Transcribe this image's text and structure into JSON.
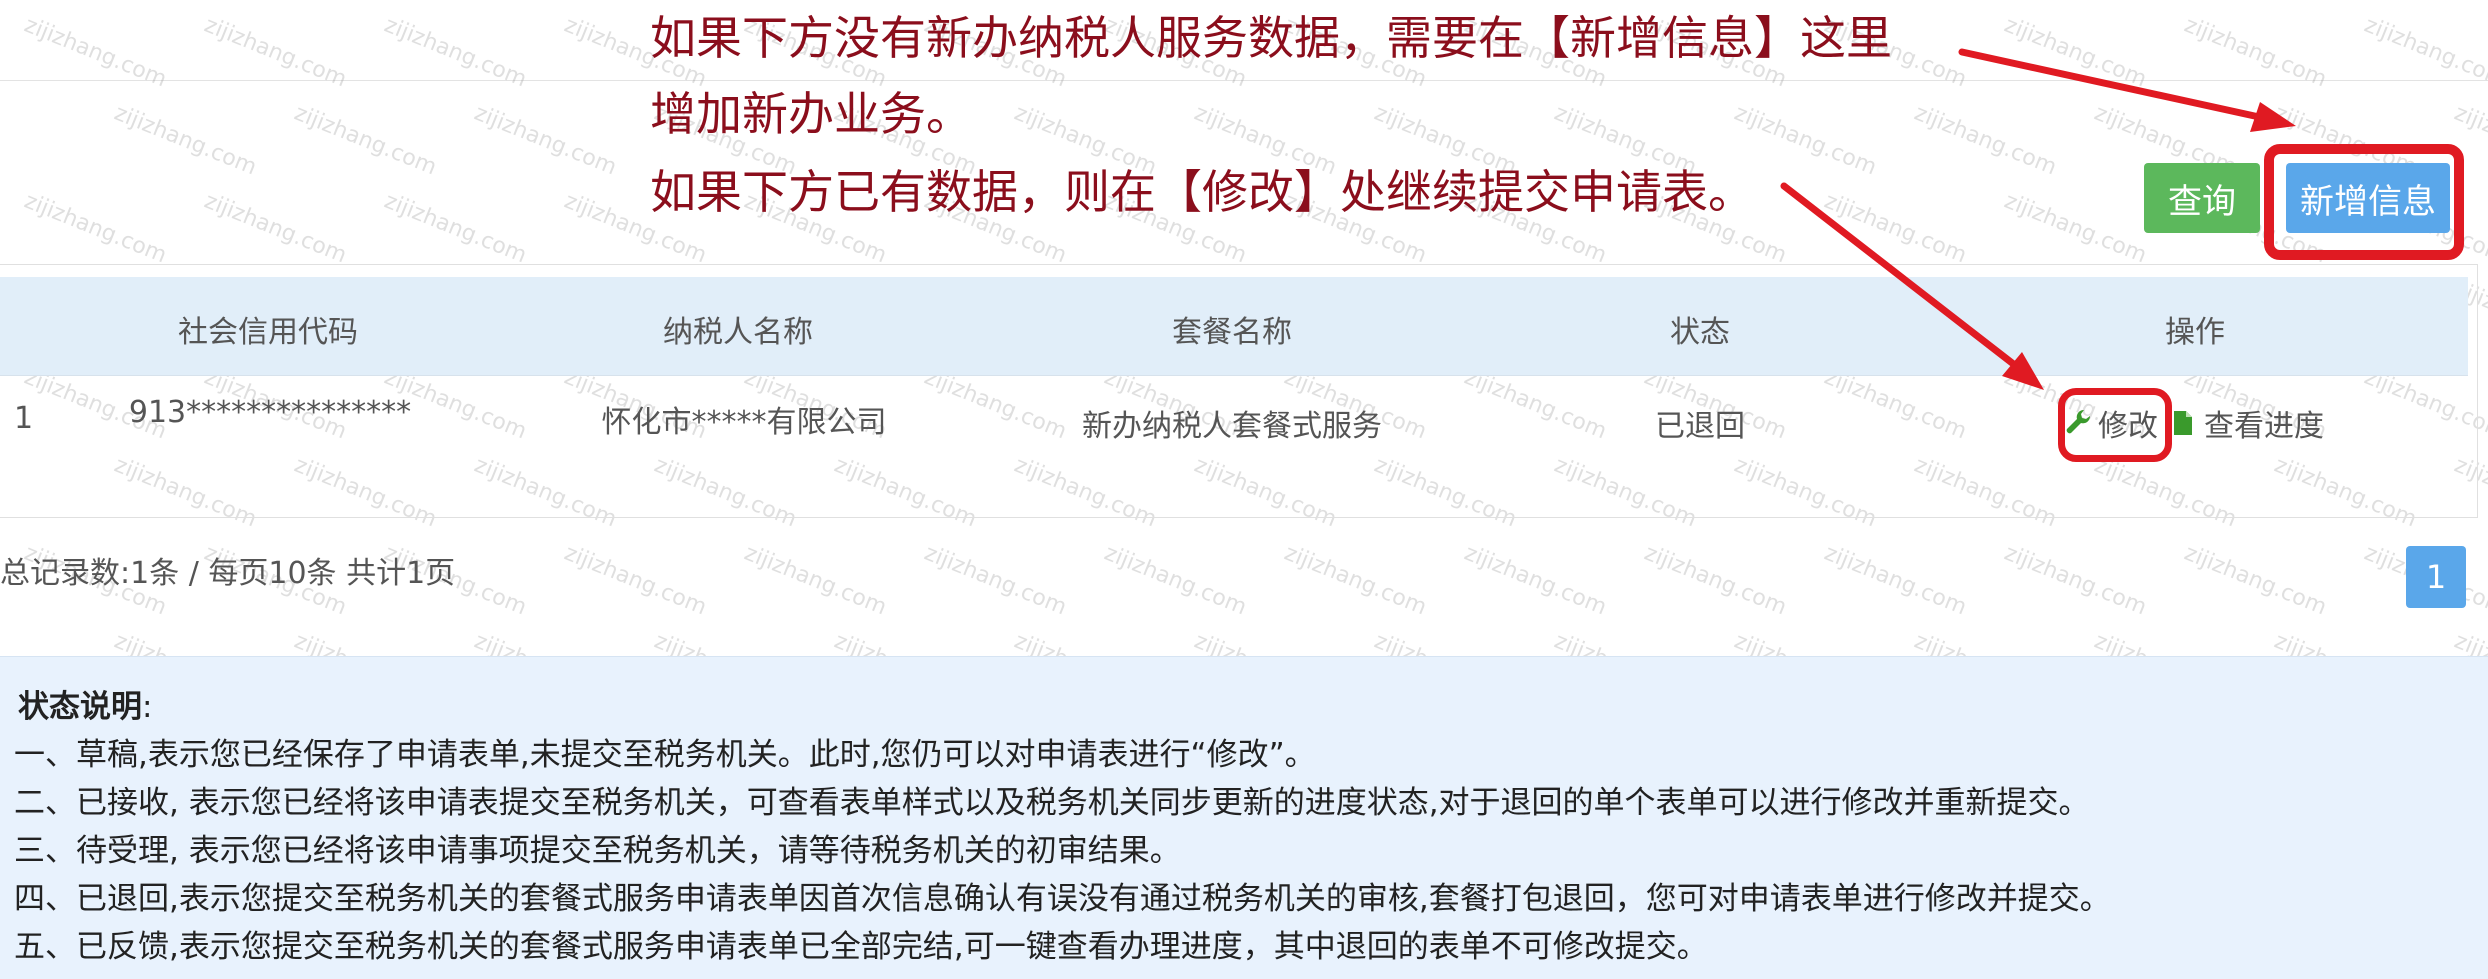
{
  "annotation": {
    "line1": "如果下方没有新办纳税人服务数据，需要在【新增信息】这里",
    "line2": "增加新办业务。",
    "line3": "如果下方已有数据，则在【修改】处继续提交申请表。"
  },
  "toolbar": {
    "query_label": "查询",
    "add_label": "新增信息"
  },
  "table": {
    "headers": [
      "社会信用代码",
      "纳税人名称",
      "套餐名称",
      "状态",
      "操作"
    ],
    "rows": [
      {
        "index": "1",
        "credit_code": "913***************",
        "taxpayer_name": "怀化市*****有限公司",
        "package_name": "新办纳税人套餐式服务",
        "status": "已退回",
        "edit_label": "修改",
        "progress_label": "查看进度"
      }
    ]
  },
  "pager": {
    "info": "总记录数:1条 / 每页10条 共计1页",
    "current_page": "1"
  },
  "notes": {
    "title": "状态说明",
    "colon": ":",
    "items": [
      "一、草稿,表示您已经保存了申请表单,未提交至税务机关。此时,您仍可以对申请表进行“修改”。",
      "二、已接收, 表示您已经将该申请表提交至税务机关，可查看表单样式以及税务机关同步更新的进度状态,对于退回的单个表单可以进行修改并重新提交。",
      "三、待受理, 表示您已经将该申请事项提交至税务机关，请等待税务机关的初审结果。",
      "四、已退回,表示您提交至税务机关的套餐式服务申请表单因首次信息确认有误没有通过税务机关的审核,套餐打包退回，您可对申请表单进行修改并提交。",
      "五、已反馈,表示您提交至税务机关的套餐式服务申请表单已全部完结,可一键查看办理进度，其中退回的表单不可修改提交。"
    ]
  },
  "watermark_text": "zijizhang.com",
  "colors": {
    "annotation_text": "#8b0e1c",
    "highlight_red": "#e01a22",
    "query_button": "#5cb85c",
    "primary_button": "#5aa7ea",
    "table_header_bg": "#e1eef9",
    "notes_bg": "#e8f2fd",
    "wrench_icon": "#3a9a2c"
  },
  "icons": {
    "edit": "wrench-icon",
    "progress": "document-icon"
  }
}
